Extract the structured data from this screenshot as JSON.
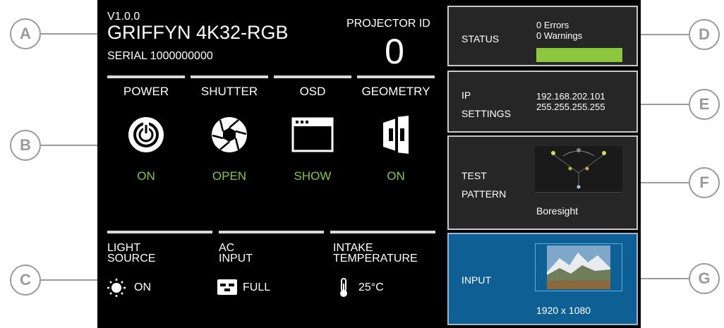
{
  "callouts": [
    "A",
    "B",
    "C",
    "D",
    "E",
    "F",
    "G"
  ],
  "header": {
    "version": "V1.0.0",
    "model": "GRIFFYN 4K32-RGB",
    "serial": "SERIAL 1000000000",
    "projector_id_label": "PROJECTOR ID",
    "projector_id_value": "0"
  },
  "controls": [
    {
      "label": "POWER",
      "state": "ON",
      "icon": "power-icon"
    },
    {
      "label": "SHUTTER",
      "state": "OPEN",
      "icon": "shutter-icon"
    },
    {
      "label": "OSD",
      "state": "SHOW",
      "icon": "osd-window-icon"
    },
    {
      "label": "GEOMETRY",
      "state": "ON",
      "icon": "geometry-icon"
    }
  ],
  "status_info": {
    "light_source": {
      "label_line1": "LIGHT",
      "label_line2": "SOURCE",
      "value": "ON",
      "icon": "sun-icon"
    },
    "ac_input": {
      "label_line1": "AC",
      "label_line2": "INPUT",
      "value": "FULL",
      "icon": "plug-icon"
    },
    "intake_temperature": {
      "label_line1": "INTAKE",
      "label_line2": "TEMPERATURE",
      "value": "25°C",
      "icon": "thermometer-icon"
    }
  },
  "tiles": {
    "status": {
      "label": "STATUS",
      "errors": "0 Errors",
      "warnings": "0 Warnings",
      "health": 1.0,
      "bar_color": "#8dc63f"
    },
    "ip_settings": {
      "label_line1": "IP",
      "label_line2": "SETTINGS",
      "ip": "192.168.202.101",
      "mask": "255.255.255.255"
    },
    "test_pattern": {
      "label_line1": "TEST",
      "label_line2": "PATTERN",
      "pattern_name": "Boresight"
    },
    "input": {
      "label": "INPUT",
      "resolution": "1920 x 1080",
      "thumbnail": "mountain-landscape-thumbnail"
    }
  },
  "colors": {
    "accent_green": "#8dc63f",
    "input_blue": "#0e5f94",
    "panel_black": "#000000"
  }
}
